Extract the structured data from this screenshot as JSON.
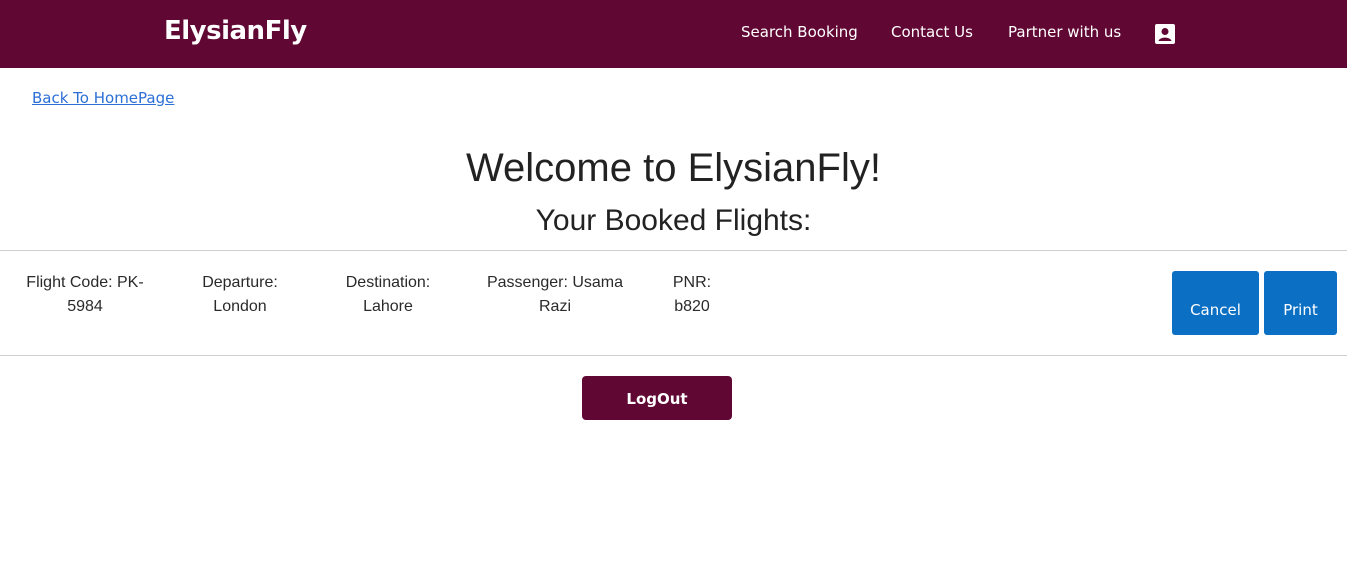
{
  "navbar": {
    "brand": "ElysianFly",
    "links": [
      "Search Booking",
      "Contact Us",
      "Partner with us"
    ],
    "account_icon": "account-box-icon",
    "background_color": "#600733"
  },
  "back_link": "Back To HomePage",
  "welcome_title": "Welcome to ElysianFly!",
  "subtitle": "Your Booked Flights:",
  "booking": {
    "flight_code": "Flight Code: PK-5984",
    "departure": "Departure: London",
    "destination": "Destination: Lahore",
    "passenger": "Passenger: Usama Razi",
    "pnr": "PNR: b820"
  },
  "buttons": {
    "cancel": "Cancel",
    "print": "Print",
    "logout": "LogOut"
  },
  "colors": {
    "primary_button": "#0b70c4",
    "link": "#2c6fd6"
  }
}
